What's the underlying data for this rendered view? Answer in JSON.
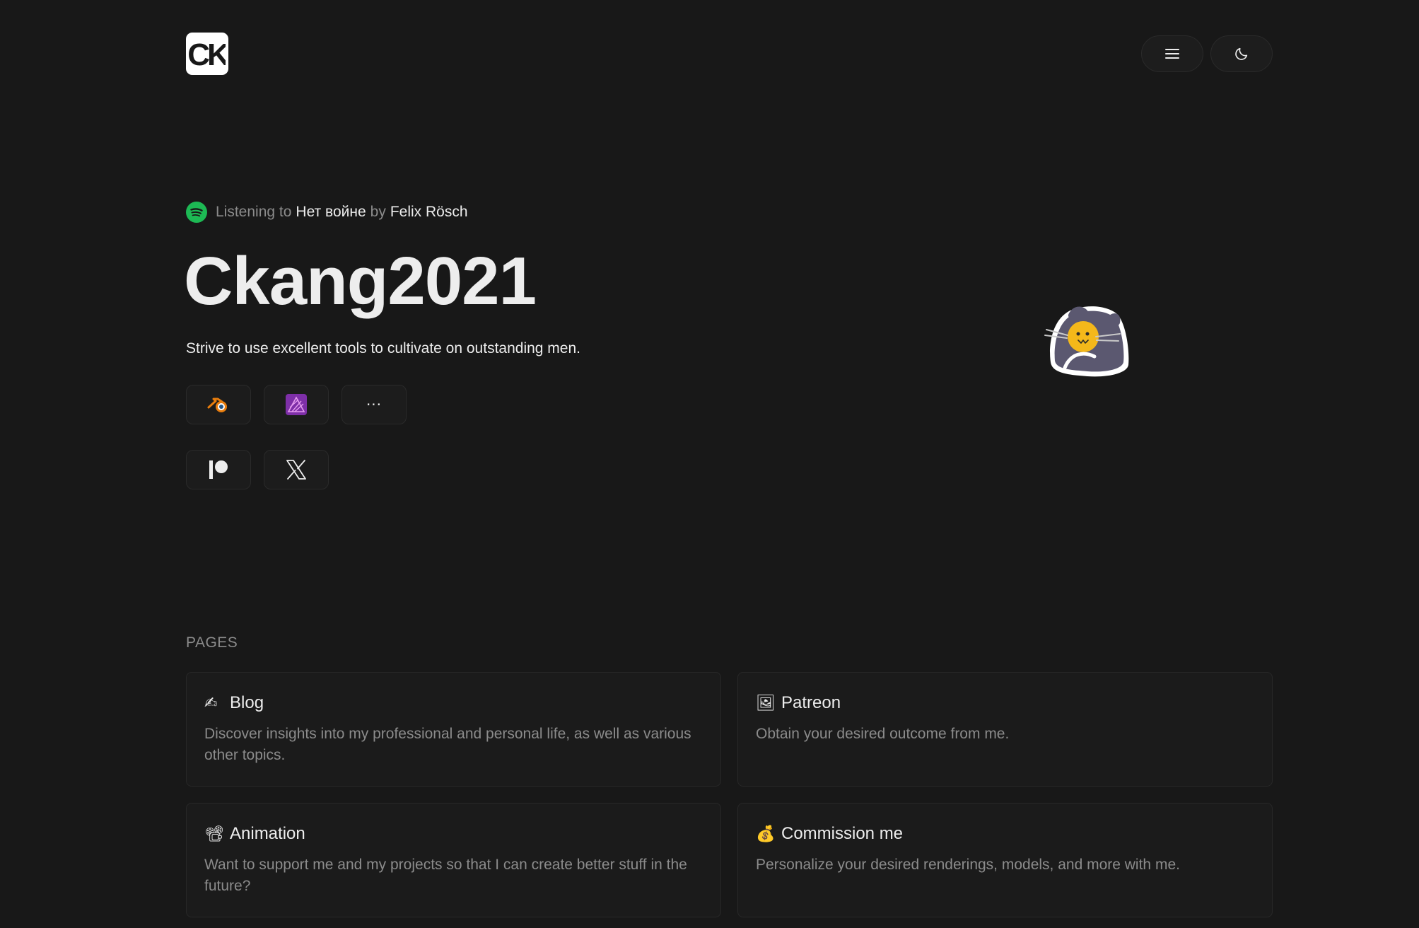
{
  "header": {
    "logo_text": "CK",
    "menu_icon": "menu-icon",
    "theme_icon": "moon-icon"
  },
  "now_playing": {
    "prefix": "Listening to",
    "track": "Нет войне",
    "joiner": "by",
    "artist": "Felix Rösch",
    "icon": "spotify-icon"
  },
  "profile": {
    "name": "Ckang2021",
    "tagline": "Strive to use excellent tools to cultivate on outstanding men."
  },
  "tools": [
    {
      "icon": "blender-icon"
    },
    {
      "icon": "affinity-photo-icon"
    },
    {
      "icon": "more-icon",
      "label": "···"
    }
  ],
  "socials": [
    {
      "icon": "patreon-icon"
    },
    {
      "icon": "x-icon"
    }
  ],
  "pages": {
    "label": "PAGES",
    "items": [
      {
        "emoji": "✍",
        "title": "Blog",
        "desc": "Discover insights into my professional and personal life, as well as various other topics."
      },
      {
        "emoji": "🖼",
        "title": "Patreon",
        "desc": "Obtain your desired outcome from me."
      },
      {
        "emoji": "📽",
        "title": "Animation",
        "desc": "Want to support me and my projects so that I can create better stuff in the future?"
      },
      {
        "emoji": "💰",
        "title": "Commission me",
        "desc": "Personalize your desired renderings, models, and more with me."
      }
    ]
  },
  "colors": {
    "background": "#181818",
    "spotify_green": "#1db954",
    "blender_orange": "#e87d0d",
    "affinity_purple": "#c651d6"
  }
}
